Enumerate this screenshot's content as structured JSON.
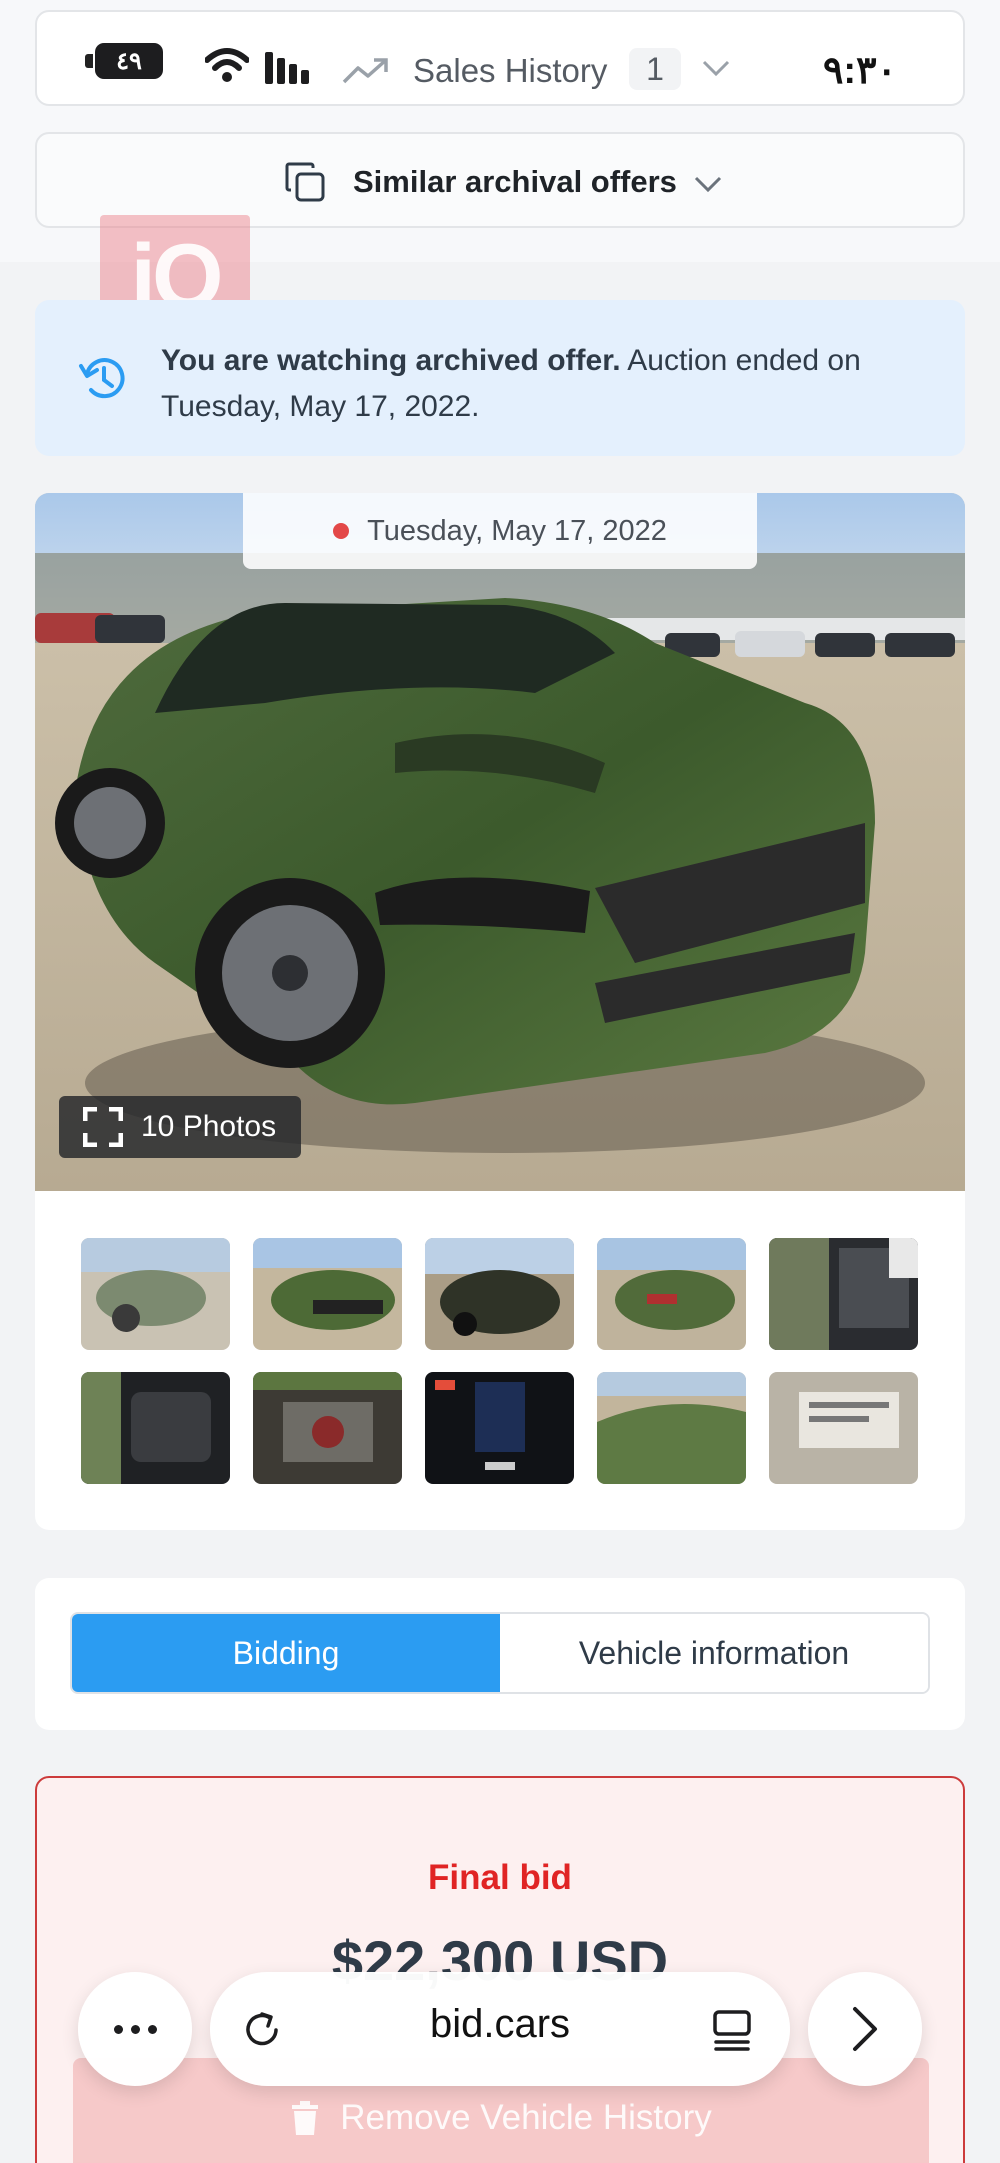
{
  "status_bar": {
    "battery": "٤٩",
    "clock": "٩:٣٠"
  },
  "sales_history": {
    "label": "Sales History",
    "count": "1",
    "icon": "trend-up-icon"
  },
  "similar_offers": {
    "label": "Similar archival offers",
    "icon": "copy-icon"
  },
  "logo": {
    "text": "iQ",
    "color": "#ec7882"
  },
  "archive_notice": {
    "bold": "You are watching archived offer.",
    "text": " Auction ended on Tuesday, May 17, 2022.",
    "icon": "history-icon",
    "accent": "#2b9cf2"
  },
  "gallery": {
    "date": "Tuesday, May 17, 2022",
    "photos_label": "10 Photos",
    "thumbnail_count": 10
  },
  "tabs": [
    {
      "label": "Bidding",
      "active": true
    },
    {
      "label": "Vehicle information",
      "active": false
    }
  ],
  "bid": {
    "title": "Final bid",
    "amount": "$22,300 USD",
    "remove_label": "Remove Vehicle History",
    "accent": "#e02424"
  },
  "browser": {
    "domain": "bid.cars"
  }
}
